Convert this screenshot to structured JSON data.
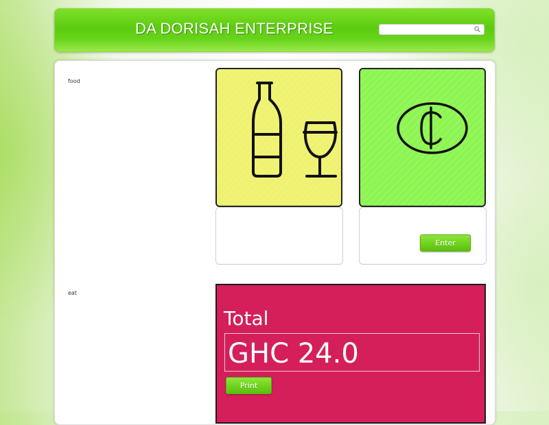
{
  "header": {
    "title": "DA DORISAH ENTERPRISE",
    "search": {
      "value": "",
      "placeholder": "",
      "icon": "search-icon"
    }
  },
  "sidebar": {
    "labels": [
      "food",
      "eat"
    ]
  },
  "tiles": [
    {
      "icon": "bottle-and-wine-glass-icon",
      "color": "#eef26e"
    },
    {
      "icon": "cedi-coin-icon",
      "color": "#8df551"
    }
  ],
  "enter_button": {
    "label": "Enter"
  },
  "total": {
    "label": "Total",
    "value": "GHC 24.0",
    "print_label": "Print",
    "color": "#d41f5b"
  },
  "colors": {
    "header_green": "#5ccc10",
    "button_green": "#6fd21c"
  }
}
